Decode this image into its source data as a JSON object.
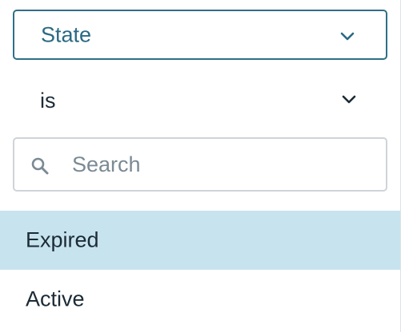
{
  "filter": {
    "field_select": {
      "label": "State",
      "icon": "chevron-down-icon"
    },
    "operator_select": {
      "label": "is",
      "icon": "chevron-down-icon"
    },
    "search": {
      "placeholder": "Search",
      "value": "",
      "icon": "search-icon"
    },
    "options": [
      {
        "label": "Expired",
        "highlighted": true
      },
      {
        "label": "Active",
        "highlighted": false
      }
    ]
  },
  "colors": {
    "accent_border": "#2f6f86",
    "accent_text": "#2a6a84",
    "highlight_row": "#c7e3ee",
    "input_border": "#cfd4d8",
    "placeholder": "#7b8a94"
  }
}
